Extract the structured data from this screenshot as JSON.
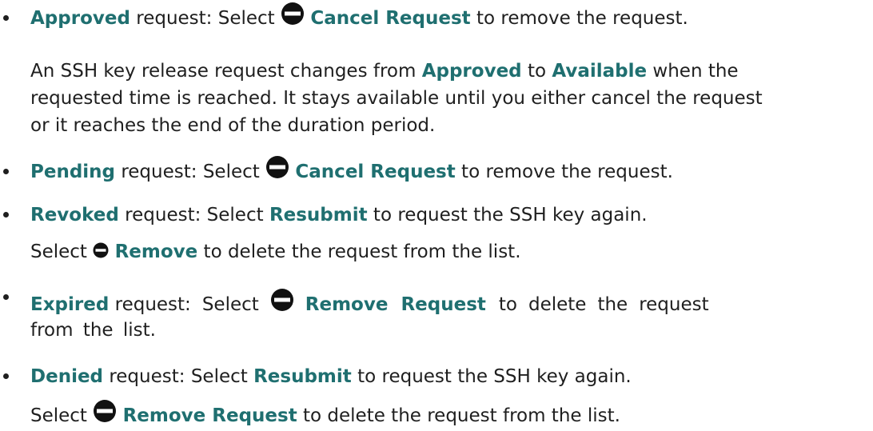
{
  "items": [
    {
      "status": "Approved",
      "text_after_status": " request: Select ",
      "action": "Cancel Request",
      "text_after_action": " to remove the request.",
      "note_line1_a": "An SSH key release request changes from ",
      "note_from": "Approved",
      "note_line1_b": " to ",
      "note_to": "Available",
      "note_line1_c": " when the",
      "note_line2": "requested time is reached. It stays available until you either cancel the request",
      "note_line3": "or it reaches the end of the duration period."
    },
    {
      "status": "Pending",
      "text_after_status": " request: Select ",
      "action": "Cancel Request",
      "text_after_action": " to remove the request."
    },
    {
      "status": "Revoked",
      "text_after_status": " request: Select ",
      "action": "Resubmit",
      "text_after_action": " to request the SSH key again.",
      "sub_select": "Select ",
      "sub_action": "Remove",
      "sub_after": " to delete the request from the list."
    },
    {
      "status": "Expired",
      "text_after_status": " request:",
      "select_word": "Select",
      "action": "Remove Request",
      "to_word": "to",
      "delete_word": "delete",
      "the_word": "the",
      "request_word": "request",
      "line2": "from the list."
    },
    {
      "status": "Denied",
      "text_after_status": " request: Select ",
      "action": "Resubmit",
      "text_after_action": " to request the SSH key again.",
      "sub_select": "Select ",
      "sub_action": "Remove Request",
      "sub_after": " to delete the request from the list."
    }
  ],
  "icon_name": "minus-circle-icon",
  "colors": {
    "text": "#1f1f1f",
    "keyword": "#1f6f70"
  }
}
